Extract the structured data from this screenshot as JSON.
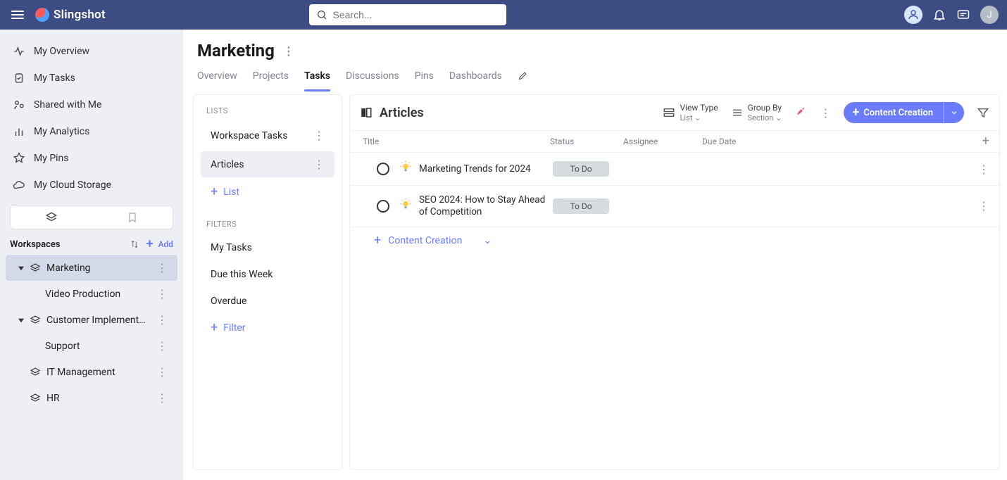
{
  "brand": "Slingshot",
  "search": {
    "placeholder": "Search..."
  },
  "top_avatar_initial": "J",
  "sidebar": {
    "nav": [
      {
        "label": "My Overview"
      },
      {
        "label": "My Tasks"
      },
      {
        "label": "Shared with Me"
      },
      {
        "label": "My Analytics"
      },
      {
        "label": "My Pins"
      },
      {
        "label": "My Cloud Storage"
      }
    ],
    "workspaces_label": "Workspaces",
    "add_label": "Add",
    "workspaces": {
      "marketing": {
        "label": "Marketing"
      },
      "video_production": {
        "label": "Video Production"
      },
      "customer_impl": {
        "label": "Customer Implementa..."
      },
      "support": {
        "label": "Support"
      },
      "it_management": {
        "label": "IT Management"
      },
      "hr": {
        "label": "HR"
      }
    }
  },
  "page": {
    "title": "Marketing",
    "tabs": {
      "overview": "Overview",
      "projects": "Projects",
      "tasks": "Tasks",
      "discussions": "Discussions",
      "pins": "Pins",
      "dashboards": "Dashboards"
    }
  },
  "lists": {
    "header": "LISTS",
    "items": {
      "workspace_tasks": "Workspace Tasks",
      "articles": "Articles"
    },
    "add_list": "List",
    "filters_header": "FILTERS",
    "filters": {
      "my_tasks": "My Tasks",
      "due_week": "Due this Week",
      "overdue": "Overdue"
    },
    "add_filter": "Filter"
  },
  "tasks": {
    "title": "Articles",
    "view_type_label": "View Type",
    "view_type_value": "List",
    "group_by_label": "Group By",
    "group_by_value": "Section",
    "primary_button": "Content Creation",
    "columns": {
      "title": "Title",
      "status": "Status",
      "assignee": "Assignee",
      "due": "Due Date"
    },
    "rows": [
      {
        "title": "Marketing Trends for 2024",
        "status": "To Do"
      },
      {
        "title": "SEO 2024: How to Stay Ahead of Competition",
        "status": "To Do"
      }
    ],
    "add_task_label": "Content Creation"
  }
}
